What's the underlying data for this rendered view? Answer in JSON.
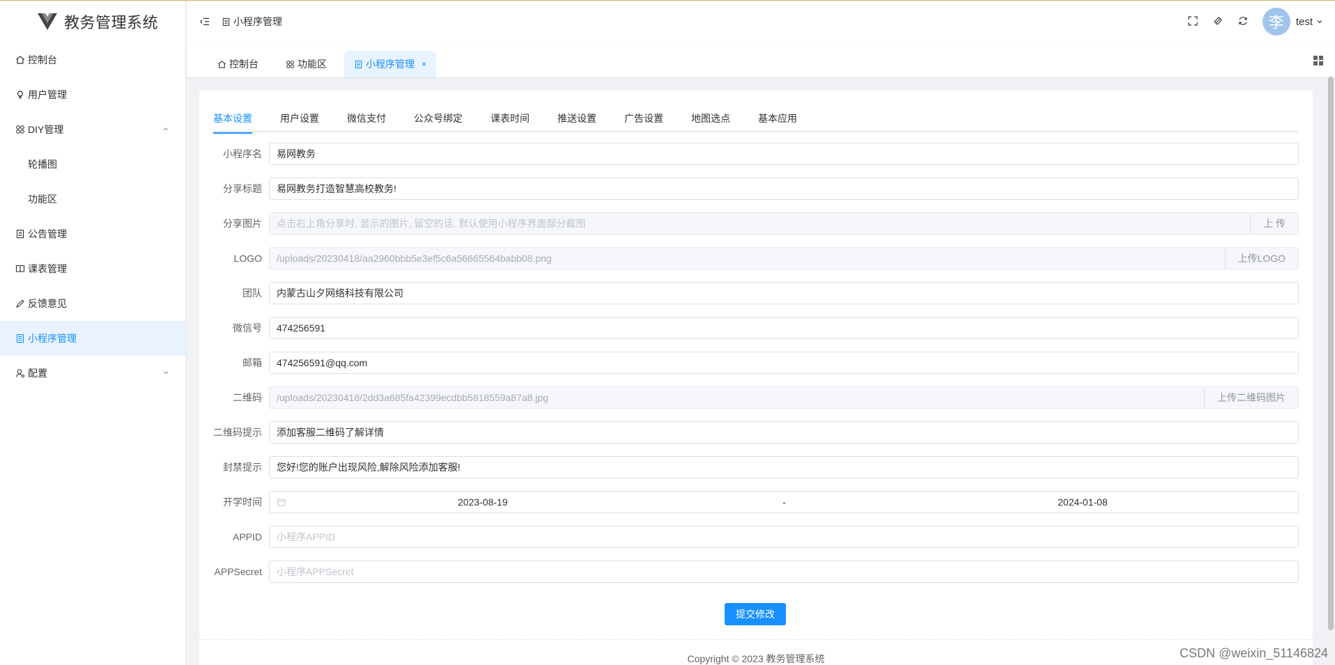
{
  "app": {
    "title": "教务管理系统"
  },
  "sidebar": {
    "items": [
      {
        "label": "控制台",
        "icon": "home-icon"
      },
      {
        "label": "用户管理",
        "icon": "user-bulb-icon"
      },
      {
        "label": "DIY管理",
        "icon": "apps-icon",
        "expanded": true
      },
      {
        "label": "轮播图",
        "sub": true
      },
      {
        "label": "功能区",
        "sub": true
      },
      {
        "label": "公告管理",
        "icon": "doc-icon"
      },
      {
        "label": "课表管理",
        "icon": "book-icon"
      },
      {
        "label": "反馈意见",
        "icon": "pen-icon"
      },
      {
        "label": "小程序管理",
        "icon": "doc-icon",
        "active": true
      },
      {
        "label": "配置",
        "icon": "user-gear-icon",
        "expanded": false
      }
    ]
  },
  "header": {
    "breadcrumb": "小程序管理",
    "user": {
      "avatar_char": "李",
      "name": "test"
    }
  },
  "tagsbar": {
    "tags": [
      {
        "label": "控制台"
      },
      {
        "label": "功能区"
      },
      {
        "label": "小程序管理",
        "active": true,
        "close": "×"
      }
    ]
  },
  "tabs": [
    "基本设置",
    "用户设置",
    "微信支付",
    "公众号绑定",
    "课表时间",
    "推送设置",
    "广告设置",
    "地图选点",
    "基本应用"
  ],
  "form": {
    "name": {
      "label": "小程序名",
      "value": "易网教务"
    },
    "share_title": {
      "label": "分享标题",
      "value": "易网教务打造智慧高校教务!"
    },
    "share_image": {
      "label": "分享图片",
      "value": "",
      "placeholder": "点击右上角分享时, 显示的图片, 留空的话, 默认使用小程序界面部分截图",
      "button": "上 传"
    },
    "logo": {
      "label": "LOGO",
      "value": "/uploads/20230418/aa2960bbb5e3ef5c6a56665564babb08.png",
      "button": "上传LOGO"
    },
    "team": {
      "label": "团队",
      "value": "内蒙古山夕网络科技有限公司"
    },
    "wechat": {
      "label": "微信号",
      "value": "474256591"
    },
    "email": {
      "label": "邮箱",
      "value": "474256591@qq.com"
    },
    "qrcode": {
      "label": "二维码",
      "value": "/uploads/20230418/2dd3a685fa42399ecdbb5818559a87a8.jpg",
      "button": "上传二维码图片"
    },
    "qrcode_tip": {
      "label": "二维码提示",
      "value": "添加客服二维码了解详情"
    },
    "ban_tip": {
      "label": "封禁提示",
      "value": "您好!您的账户出现风险,解除风险添加客服!"
    },
    "term": {
      "label": "开学时间",
      "start": "2023-08-19",
      "separator": "-",
      "end": "2024-01-08"
    },
    "appid": {
      "label": "APPID",
      "value": "",
      "placeholder": "小程序APPID"
    },
    "appsecret": {
      "label": "APPSecret",
      "value": "",
      "placeholder": "小程序APPSecret"
    },
    "submit": "提交修改"
  },
  "footer": {
    "text": "Copyright © 2023 教务管理系统"
  },
  "watermark": "CSDN @weixin_51146824",
  "colors": {
    "accent": "#1890ff",
    "active_bg": "#e8f3ff",
    "avatar": "#a0c4ec"
  }
}
